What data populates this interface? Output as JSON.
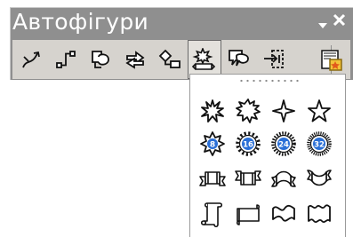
{
  "toolbar": {
    "title": "Автофігури",
    "menu_icon": "dropdown-triangle-icon",
    "close_icon": "close-icon",
    "buttons": [
      {
        "name": "lines-button",
        "icon": "lines-icon"
      },
      {
        "name": "connectors-button",
        "icon": "connectors-icon"
      },
      {
        "name": "basic-shapes-button",
        "icon": "basic-shapes-icon"
      },
      {
        "name": "block-arrows-button",
        "icon": "block-arrows-icon"
      },
      {
        "name": "flowchart-button",
        "icon": "flowchart-icon"
      },
      {
        "name": "stars-and-banners-button",
        "icon": "stars-banners-icon",
        "active": true
      },
      {
        "name": "callouts-button",
        "icon": "callouts-icon"
      },
      {
        "name": "action-buttons-button",
        "icon": "action-buttons-icon"
      },
      {
        "name": "more-autoshapes-button",
        "icon": "clip-art-folder-icon"
      }
    ]
  },
  "palette": {
    "rows": [
      [
        "explosion-1-icon",
        "explosion-2-icon",
        "4-point-star-icon",
        "5-point-star-icon"
      ],
      [
        "8-point-star-icon",
        "16-point-star-icon",
        "24-point-star-icon",
        "32-point-star-icon"
      ],
      [
        "up-ribbon-icon",
        "down-ribbon-icon",
        "curved-up-ribbon-icon",
        "curved-down-ribbon-icon"
      ],
      [
        "vertical-scroll-icon",
        "horizontal-scroll-icon",
        "wave-icon",
        "double-wave-icon"
      ]
    ],
    "badges": [
      "8",
      "16",
      "24",
      "32"
    ],
    "colors": {
      "badge": "#2a6fd6",
      "icon_stroke": "#1a1a1a"
    }
  }
}
